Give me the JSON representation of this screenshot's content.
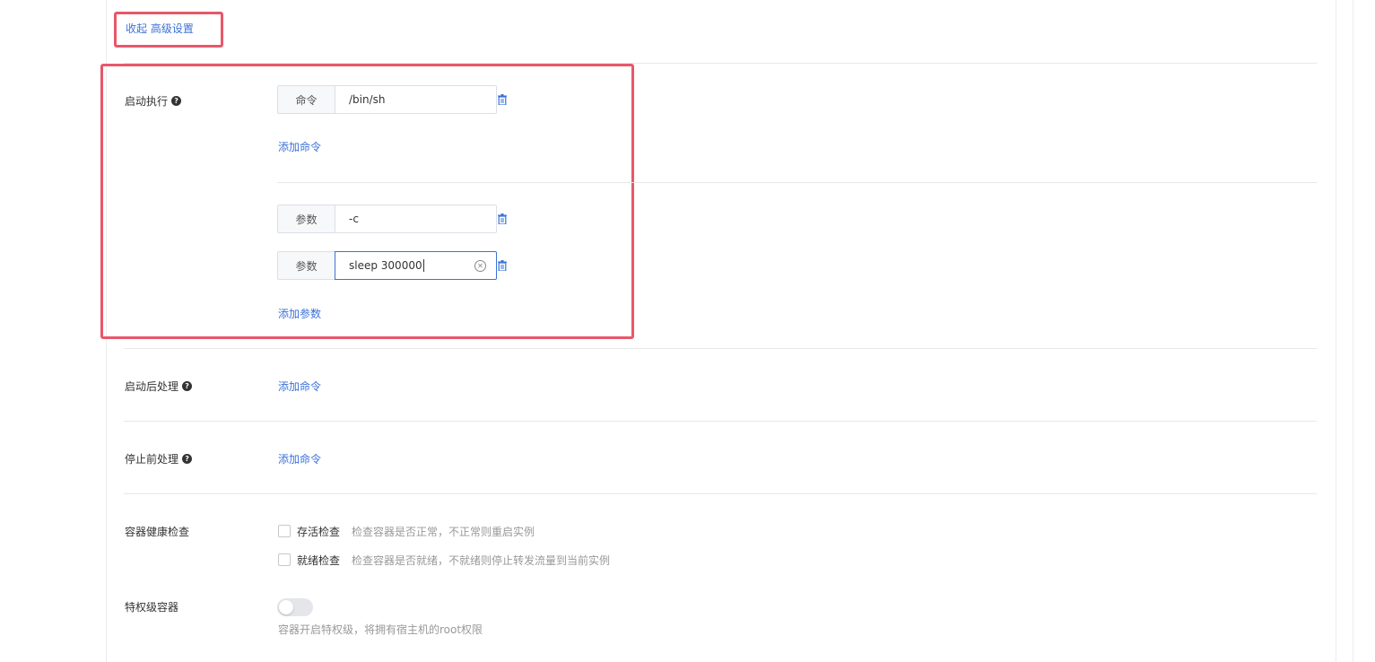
{
  "toggle_advanced": {
    "label": "收起 高级设置"
  },
  "startup_exec": {
    "label": "启动执行",
    "command": {
      "addon": "命令",
      "value": "/bin/sh"
    },
    "add_command": "添加命令",
    "args": [
      {
        "addon": "参数",
        "value": "-c"
      },
      {
        "addon": "参数",
        "value": "sleep 300000"
      }
    ],
    "add_arg": "添加参数"
  },
  "post_start": {
    "label": "启动后处理",
    "add_command": "添加命令"
  },
  "pre_stop": {
    "label": "停止前处理",
    "add_command": "添加命令"
  },
  "health_check": {
    "label": "容器健康检查",
    "options": [
      {
        "label": "存活检查",
        "desc": "检查容器是否正常，不正常则重启实例",
        "checked": false
      },
      {
        "label": "就绪检查",
        "desc": "检查容器是否就绪，不就绪则停止转发流量到当前实例",
        "checked": false
      }
    ]
  },
  "privileged": {
    "label": "特权级容器",
    "enabled": false,
    "desc": "容器开启特权级，将拥有宿主机的root权限"
  },
  "colors": {
    "accent": "#3b72d8",
    "highlight": "#e8576a"
  }
}
